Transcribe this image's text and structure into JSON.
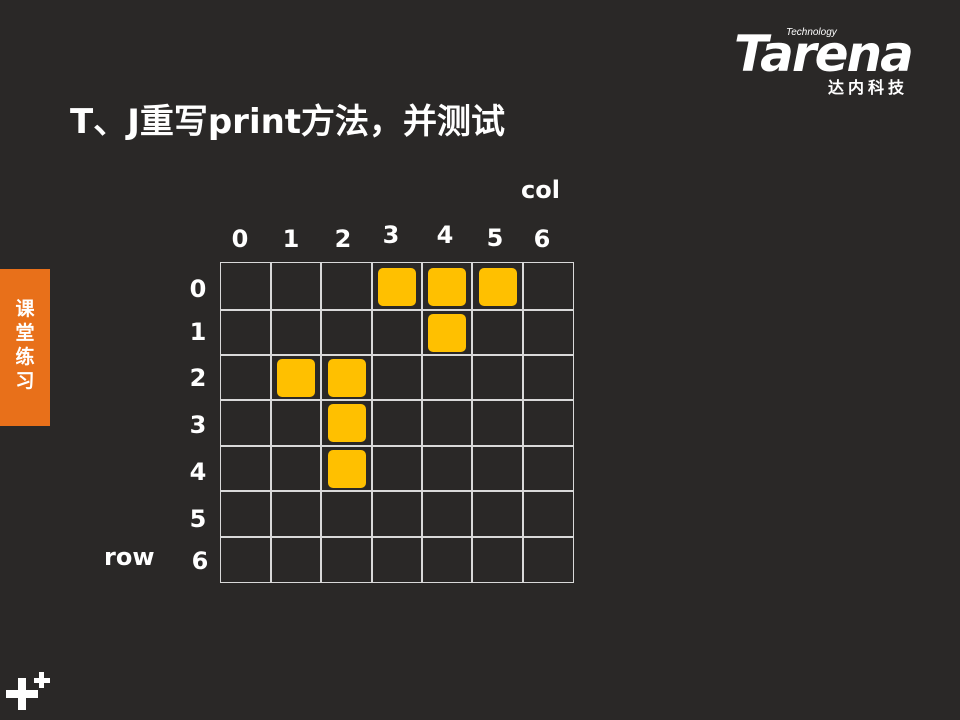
{
  "logo": {
    "small_text": "Technology",
    "main_text": "Tarena",
    "cn_text": "达内科技"
  },
  "title": "T、J重写print方法，并测试",
  "side_tab": "课堂练习",
  "axis": {
    "col_label": "col",
    "row_label": "row"
  },
  "col_numbers": [
    "0",
    "1",
    "2",
    "3",
    "4",
    "5",
    "6"
  ],
  "row_numbers": [
    "0",
    "1",
    "2",
    "3",
    "4",
    "5",
    "6"
  ],
  "blocks_color": "#ffc000",
  "blocks": [
    {
      "row": 0,
      "col": 3
    },
    {
      "row": 0,
      "col": 4
    },
    {
      "row": 0,
      "col": 5
    },
    {
      "row": 1,
      "col": 4
    },
    {
      "row": 2,
      "col": 1
    },
    {
      "row": 2,
      "col": 2
    },
    {
      "row": 3,
      "col": 2
    },
    {
      "row": 4,
      "col": 2
    }
  ]
}
